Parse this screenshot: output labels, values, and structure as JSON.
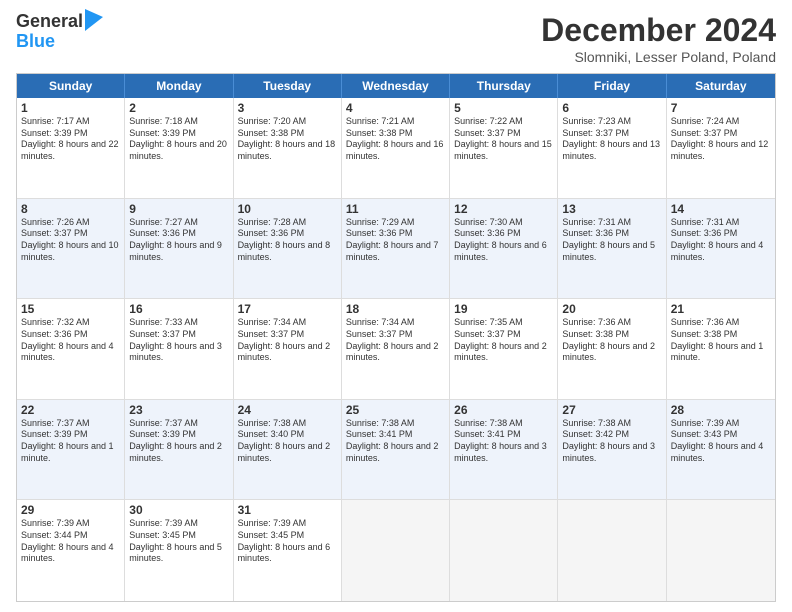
{
  "logo": {
    "general": "General",
    "blue": "Blue"
  },
  "title": "December 2024",
  "location": "Slomniki, Lesser Poland, Poland",
  "days": [
    "Sunday",
    "Monday",
    "Tuesday",
    "Wednesday",
    "Thursday",
    "Friday",
    "Saturday"
  ],
  "weeks": [
    [
      {
        "day": "1",
        "sunrise": "7:17 AM",
        "sunset": "3:39 PM",
        "daylight": "8 hours and 22 minutes."
      },
      {
        "day": "2",
        "sunrise": "7:18 AM",
        "sunset": "3:39 PM",
        "daylight": "8 hours and 20 minutes."
      },
      {
        "day": "3",
        "sunrise": "7:20 AM",
        "sunset": "3:38 PM",
        "daylight": "8 hours and 18 minutes."
      },
      {
        "day": "4",
        "sunrise": "7:21 AM",
        "sunset": "3:38 PM",
        "daylight": "8 hours and 16 minutes."
      },
      {
        "day": "5",
        "sunrise": "7:22 AM",
        "sunset": "3:37 PM",
        "daylight": "8 hours and 15 minutes."
      },
      {
        "day": "6",
        "sunrise": "7:23 AM",
        "sunset": "3:37 PM",
        "daylight": "8 hours and 13 minutes."
      },
      {
        "day": "7",
        "sunrise": "7:24 AM",
        "sunset": "3:37 PM",
        "daylight": "8 hours and 12 minutes."
      }
    ],
    [
      {
        "day": "8",
        "sunrise": "7:26 AM",
        "sunset": "3:37 PM",
        "daylight": "8 hours and 10 minutes."
      },
      {
        "day": "9",
        "sunrise": "7:27 AM",
        "sunset": "3:36 PM",
        "daylight": "8 hours and 9 minutes."
      },
      {
        "day": "10",
        "sunrise": "7:28 AM",
        "sunset": "3:36 PM",
        "daylight": "8 hours and 8 minutes."
      },
      {
        "day": "11",
        "sunrise": "7:29 AM",
        "sunset": "3:36 PM",
        "daylight": "8 hours and 7 minutes."
      },
      {
        "day": "12",
        "sunrise": "7:30 AM",
        "sunset": "3:36 PM",
        "daylight": "8 hours and 6 minutes."
      },
      {
        "day": "13",
        "sunrise": "7:31 AM",
        "sunset": "3:36 PM",
        "daylight": "8 hours and 5 minutes."
      },
      {
        "day": "14",
        "sunrise": "7:31 AM",
        "sunset": "3:36 PM",
        "daylight": "8 hours and 4 minutes."
      }
    ],
    [
      {
        "day": "15",
        "sunrise": "7:32 AM",
        "sunset": "3:36 PM",
        "daylight": "8 hours and 4 minutes."
      },
      {
        "day": "16",
        "sunrise": "7:33 AM",
        "sunset": "3:37 PM",
        "daylight": "8 hours and 3 minutes."
      },
      {
        "day": "17",
        "sunrise": "7:34 AM",
        "sunset": "3:37 PM",
        "daylight": "8 hours and 2 minutes."
      },
      {
        "day": "18",
        "sunrise": "7:34 AM",
        "sunset": "3:37 PM",
        "daylight": "8 hours and 2 minutes."
      },
      {
        "day": "19",
        "sunrise": "7:35 AM",
        "sunset": "3:37 PM",
        "daylight": "8 hours and 2 minutes."
      },
      {
        "day": "20",
        "sunrise": "7:36 AM",
        "sunset": "3:38 PM",
        "daylight": "8 hours and 2 minutes."
      },
      {
        "day": "21",
        "sunrise": "7:36 AM",
        "sunset": "3:38 PM",
        "daylight": "8 hours and 1 minute."
      }
    ],
    [
      {
        "day": "22",
        "sunrise": "7:37 AM",
        "sunset": "3:39 PM",
        "daylight": "8 hours and 1 minute."
      },
      {
        "day": "23",
        "sunrise": "7:37 AM",
        "sunset": "3:39 PM",
        "daylight": "8 hours and 2 minutes."
      },
      {
        "day": "24",
        "sunrise": "7:38 AM",
        "sunset": "3:40 PM",
        "daylight": "8 hours and 2 minutes."
      },
      {
        "day": "25",
        "sunrise": "7:38 AM",
        "sunset": "3:41 PM",
        "daylight": "8 hours and 2 minutes."
      },
      {
        "day": "26",
        "sunrise": "7:38 AM",
        "sunset": "3:41 PM",
        "daylight": "8 hours and 3 minutes."
      },
      {
        "day": "27",
        "sunrise": "7:38 AM",
        "sunset": "3:42 PM",
        "daylight": "8 hours and 3 minutes."
      },
      {
        "day": "28",
        "sunrise": "7:39 AM",
        "sunset": "3:43 PM",
        "daylight": "8 hours and 4 minutes."
      }
    ],
    [
      {
        "day": "29",
        "sunrise": "7:39 AM",
        "sunset": "3:44 PM",
        "daylight": "8 hours and 4 minutes."
      },
      {
        "day": "30",
        "sunrise": "7:39 AM",
        "sunset": "3:45 PM",
        "daylight": "8 hours and 5 minutes."
      },
      {
        "day": "31",
        "sunrise": "7:39 AM",
        "sunset": "3:45 PM",
        "daylight": "8 hours and 6 minutes."
      },
      null,
      null,
      null,
      null
    ]
  ],
  "alt_rows": [
    1,
    3
  ]
}
